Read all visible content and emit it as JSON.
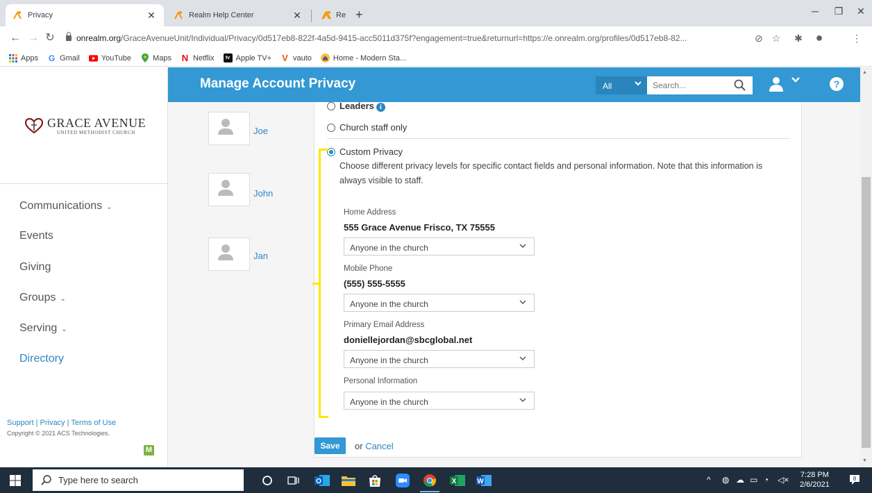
{
  "browser": {
    "tabs": [
      {
        "title": "Privacy",
        "active": true
      },
      {
        "title": "Realm Help Center",
        "active": false
      },
      {
        "title": "Realm Help Center",
        "active": false
      }
    ],
    "new_tab": "+",
    "url_domain": "onrealm.org",
    "url_path": "/GraceAvenueUnit/Individual/Privacy/0d517eb8-822f-4a5d-9415-acc5011d375f?engagement=true&returnurl=https://e.onrealm.org/profiles/0d517eb8-82...",
    "bookmarks": [
      {
        "label": "Apps",
        "icon": "apps-grid-icon"
      },
      {
        "label": "Gmail",
        "icon": "google-icon"
      },
      {
        "label": "YouTube",
        "icon": "youtube-icon"
      },
      {
        "label": "Maps",
        "icon": "maps-pin-icon"
      },
      {
        "label": "Netflix",
        "icon": "netflix-icon"
      },
      {
        "label": "Apple TV+",
        "icon": "appletv-icon"
      },
      {
        "label": "vauto",
        "icon": "vauto-icon"
      },
      {
        "label": "Home - Modern Sta...",
        "icon": "home-icon"
      }
    ]
  },
  "sidebar": {
    "logo_main": "GRACE AVENUE",
    "logo_sub": "UNITED METHODIST CHURCH",
    "nav": [
      {
        "label": "Communications",
        "has_caret": true,
        "active": false
      },
      {
        "label": "Events",
        "has_caret": false,
        "active": false
      },
      {
        "label": "Giving",
        "has_caret": false,
        "active": false
      },
      {
        "label": "Groups",
        "has_caret": true,
        "active": false
      },
      {
        "label": "Serving",
        "has_caret": true,
        "active": false
      },
      {
        "label": "Directory",
        "has_caret": false,
        "active": true
      }
    ],
    "footer_links": "Support | Privacy | Terms of Use",
    "copyright": "Copyright © 2021 ACS Technologies.",
    "badge": "M"
  },
  "header": {
    "title": "Manage Account Privacy",
    "scope": "All",
    "search_placeholder": "Search..."
  },
  "members": [
    "Joe",
    "John",
    "Jan"
  ],
  "privacy": {
    "options": [
      {
        "label": "Leaders",
        "selected": false
      },
      {
        "label": "Church staff only",
        "selected": false
      },
      {
        "label": "Custom Privacy",
        "selected": true
      }
    ],
    "custom_description": "Choose different privacy levels for specific contact fields and personal information. Note that this information is always visible to staff.",
    "fields": [
      {
        "label": "Home Address",
        "value": "555 Grace Avenue Frisco, TX 75555",
        "level": "Anyone in the church"
      },
      {
        "label": "Mobile Phone",
        "value": "(555) 555-5555",
        "level": "Anyone in the church"
      },
      {
        "label": "Primary Email Address",
        "value": "doniellejordan@sbcglobal.net",
        "level": "Anyone in the church"
      },
      {
        "label": "Personal Information",
        "value": "",
        "level": "Anyone in the church"
      }
    ],
    "save_label": "Save",
    "or_label": "or",
    "cancel_label": "Cancel"
  },
  "taskbar": {
    "search_placeholder": "Type here to search",
    "time": "7:28 PM",
    "date": "2/6/2021",
    "notifications": "8"
  },
  "colors": {
    "header": "#3398d3",
    "link": "#2e86c1",
    "highlight": "#ffe600",
    "taskbar": "#1f2d3d"
  }
}
